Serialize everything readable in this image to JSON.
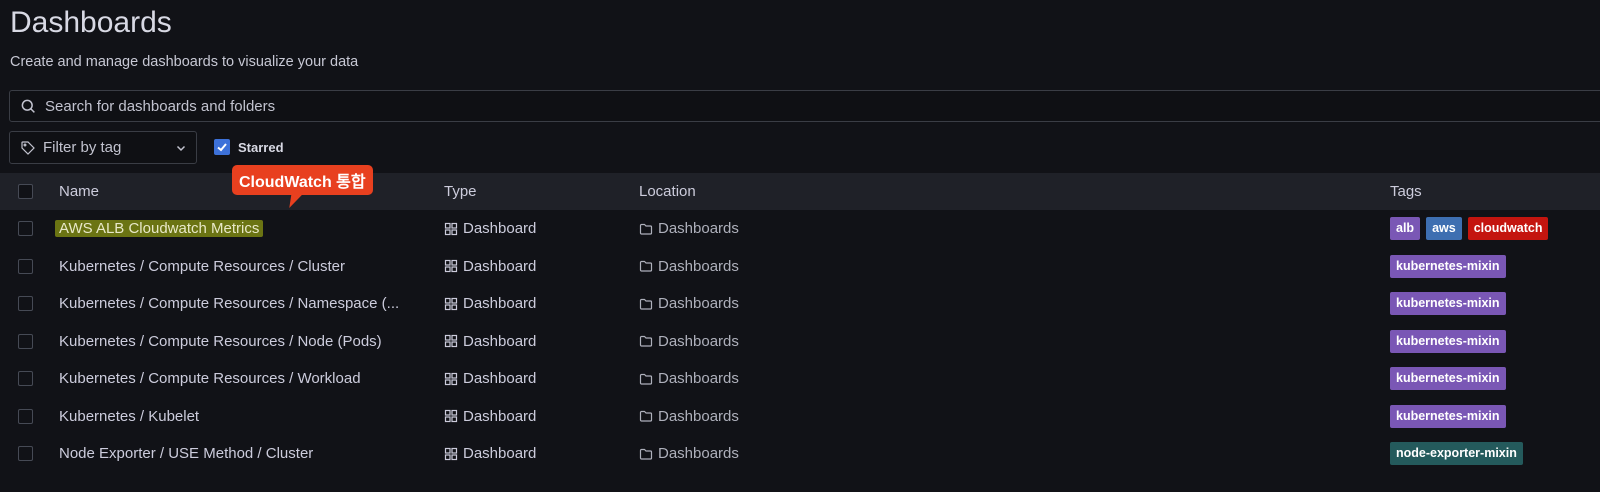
{
  "page": {
    "title": "Dashboards",
    "subtitle": "Create and manage dashboards to visualize your data"
  },
  "search": {
    "placeholder": "Search for dashboards and folders"
  },
  "filters": {
    "tag_filter_label": "Filter by tag",
    "starred_label": "Starred",
    "starred_checked": true
  },
  "table": {
    "headers": {
      "name": "Name",
      "type": "Type",
      "location": "Location",
      "tags": "Tags"
    },
    "rows": [
      {
        "name": "AWS ALB Cloudwatch Metrics",
        "type": "Dashboard",
        "location": "Dashboards",
        "tags": [
          {
            "label": "alb",
            "color": "#7a57b5"
          },
          {
            "label": "aws",
            "color": "#3e6fb1"
          },
          {
            "label": "cloudwatch",
            "color": "#c4150f"
          }
        ]
      },
      {
        "name": "Kubernetes / Compute Resources / Cluster",
        "type": "Dashboard",
        "location": "Dashboards",
        "tags": [
          {
            "label": "kubernetes-mixin",
            "color": "#7a57b5"
          }
        ]
      },
      {
        "name": "Kubernetes / Compute Resources / Namespace (...",
        "type": "Dashboard",
        "location": "Dashboards",
        "tags": [
          {
            "label": "kubernetes-mixin",
            "color": "#7a57b5"
          }
        ]
      },
      {
        "name": "Kubernetes / Compute Resources / Node (Pods)",
        "type": "Dashboard",
        "location": "Dashboards",
        "tags": [
          {
            "label": "kubernetes-mixin",
            "color": "#7a57b5"
          }
        ]
      },
      {
        "name": "Kubernetes / Compute Resources / Workload",
        "type": "Dashboard",
        "location": "Dashboards",
        "tags": [
          {
            "label": "kubernetes-mixin",
            "color": "#7a57b5"
          }
        ]
      },
      {
        "name": "Kubernetes / Kubelet",
        "type": "Dashboard",
        "location": "Dashboards",
        "tags": [
          {
            "label": "kubernetes-mixin",
            "color": "#7a57b5"
          }
        ]
      },
      {
        "name": "Node Exporter / USE Method / Cluster",
        "type": "Dashboard",
        "location": "Dashboards",
        "tags": [
          {
            "label": "node-exporter-mixin",
            "color": "#245a5c"
          }
        ]
      }
    ]
  },
  "annotation": {
    "callout_text": "CloudWatch 통합",
    "color": "#e8401f"
  }
}
